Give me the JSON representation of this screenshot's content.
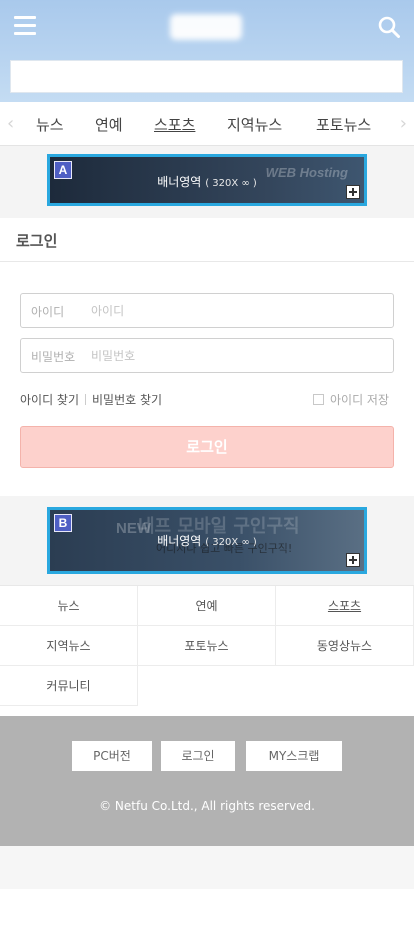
{
  "header": {
    "search_placeholder": ""
  },
  "catnav": {
    "prev_arrow": "‹",
    "next_arrow": "›",
    "items": [
      {
        "label": "뉴스"
      },
      {
        "label": "연예"
      },
      {
        "label": "스포츠"
      },
      {
        "label": "지역뉴스"
      },
      {
        "label": "포토뉴스"
      }
    ]
  },
  "banner_a": {
    "badge": "A",
    "label": "배너영역",
    "size": "( 320X ∞ )",
    "deco": "WEB Hosting"
  },
  "banner_b": {
    "badge": "B",
    "label": "배너영역",
    "size": "( 320X ∞ )",
    "deco_new": "NEW",
    "deco_title": "네프 모바일 구인구직",
    "deco_sub": "어디서나 쉽고 빠른 구인구직!"
  },
  "login": {
    "title": "로그인",
    "id_label": "아이디",
    "id_placeholder": "아이디",
    "pw_label": "비밀번호",
    "pw_placeholder": "비밀번호",
    "find_id": "아이디 찾기",
    "find_pw": "비밀번호 찾기",
    "save_id": "아이디 저장",
    "submit": "로그인"
  },
  "bottom_menu": [
    {
      "label": "뉴스"
    },
    {
      "label": "연예"
    },
    {
      "label": "스포츠"
    },
    {
      "label": "지역뉴스"
    },
    {
      "label": "포토뉴스"
    },
    {
      "label": "동영상뉴스"
    },
    {
      "label": "커뮤니티"
    }
  ],
  "footer": {
    "pc_version": "PC버전",
    "login": "로그인",
    "my_scrap": "MY스크랩",
    "copyright": "© Netfu Co.Ltd., All rights reserved."
  },
  "colors": {
    "header_bg": "#b5d2f0",
    "banner_border": "#2aa8df",
    "login_button": "#fdd1cc",
    "footer_bg": "#b2b2b2"
  }
}
